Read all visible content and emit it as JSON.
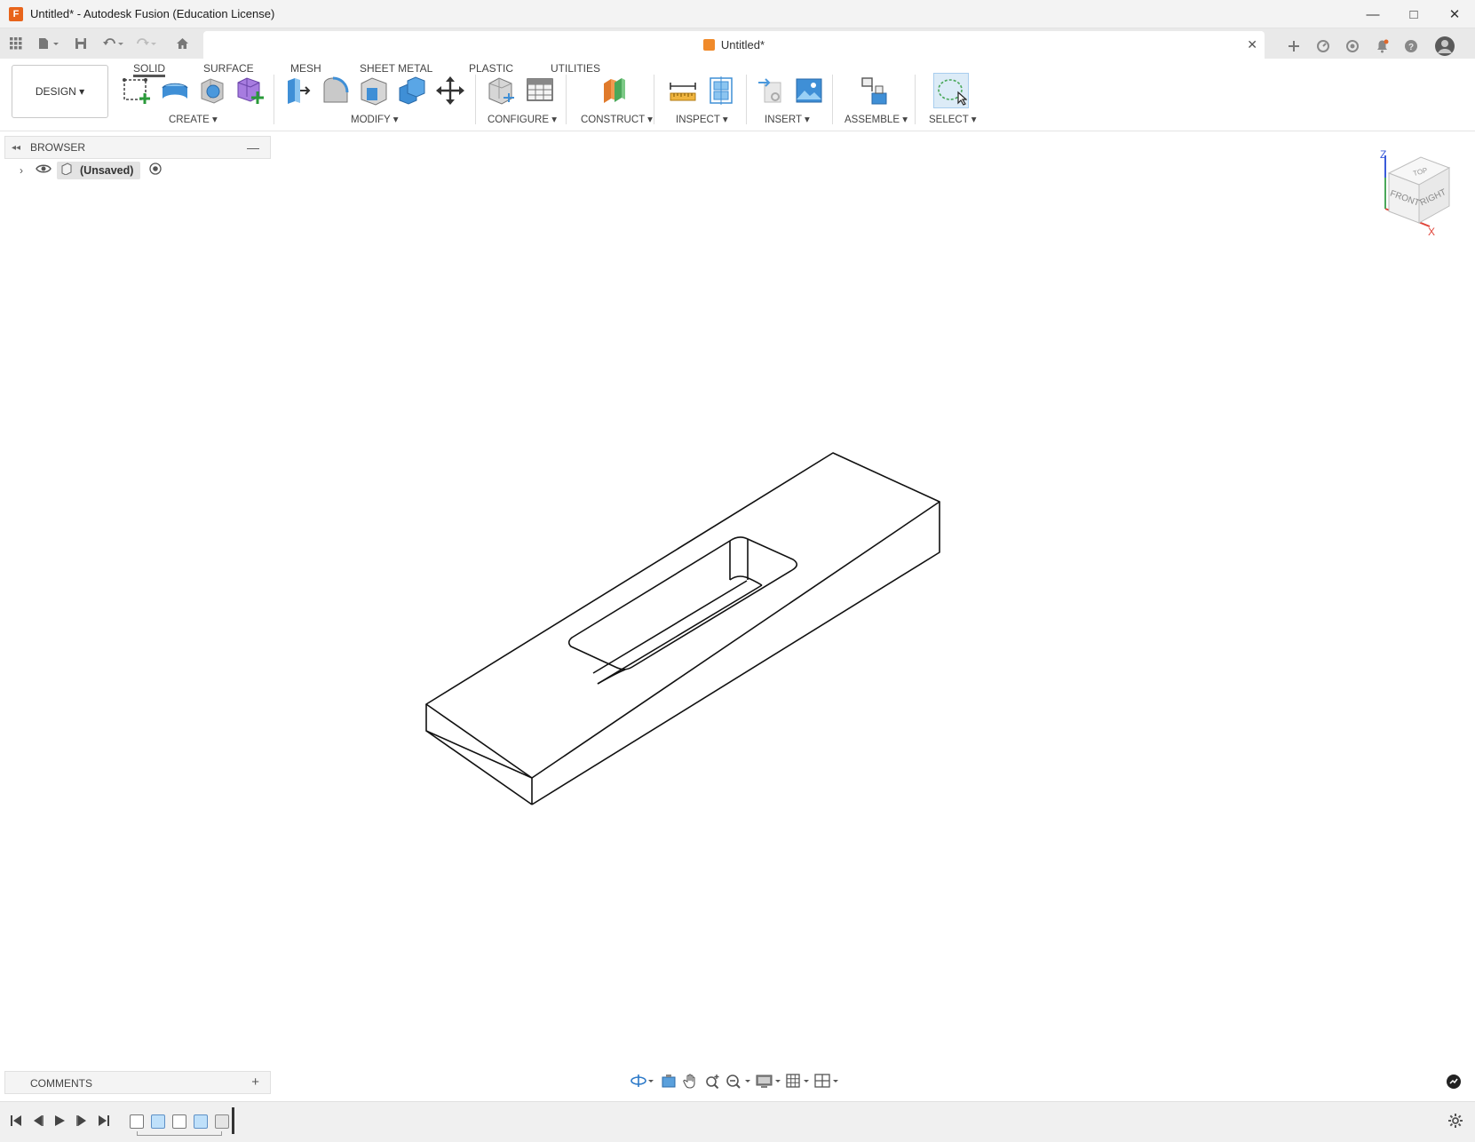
{
  "window": {
    "title": "Untitled* - Autodesk Fusion (Education License)",
    "app_icon_letter": "F",
    "minimize": "—",
    "maximize": "□",
    "close": "✕"
  },
  "document_tab": {
    "title": "Untitled*",
    "close": "✕"
  },
  "toolbar": {
    "workspace": "DESIGN ▾",
    "tabs": [
      {
        "label": "SOLID"
      },
      {
        "label": "SURFACE"
      },
      {
        "label": "MESH"
      },
      {
        "label": "SHEET METAL"
      },
      {
        "label": "PLASTIC"
      },
      {
        "label": "UTILITIES"
      }
    ],
    "groups": [
      {
        "label": "CREATE ▾"
      },
      {
        "label": "MODIFY ▾"
      },
      {
        "label": "CONFIGURE ▾"
      },
      {
        "label": "CONSTRUCT ▾"
      },
      {
        "label": "INSPECT ▾"
      },
      {
        "label": "INSERT ▾"
      },
      {
        "label": "ASSEMBLE ▾"
      },
      {
        "label": "SELECT ▾"
      }
    ]
  },
  "browser": {
    "title": "BROWSER",
    "root_node": "(Unsaved)"
  },
  "viewcube": {
    "top": "TOP",
    "front": "FRONT",
    "right": "RIGHT",
    "z_axis": "Z",
    "x_axis": "X"
  },
  "comments": {
    "title": "COMMENTS",
    "add": "+"
  },
  "colors": {
    "accent_blue": "#1d84d8",
    "sketch_orange": "#f08a2a",
    "select_highlight": "#dcebf7"
  }
}
